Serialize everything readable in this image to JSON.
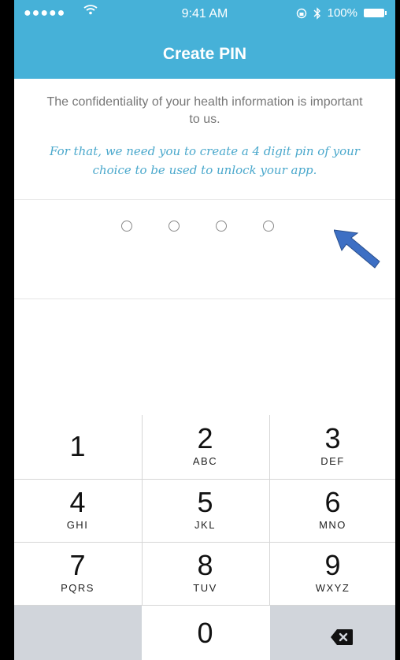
{
  "status_bar": {
    "signal": "●●●●●",
    "wifi_icon": "wifi-icon",
    "time": "9:41 AM",
    "battery_percent": "100%"
  },
  "header": {
    "title": "Create PIN"
  },
  "intro_text": "The confidentiality of your health information is important to us.",
  "instruction_text": "For that, we need you to create a 4 digit pin of your choice to be used to unlock your app.",
  "pin": {
    "length": 4,
    "entered": 0
  },
  "keypad": {
    "keys": [
      {
        "digit": "1",
        "letters": ""
      },
      {
        "digit": "2",
        "letters": "ABC"
      },
      {
        "digit": "3",
        "letters": "DEF"
      },
      {
        "digit": "4",
        "letters": "GHI"
      },
      {
        "digit": "5",
        "letters": "JKL"
      },
      {
        "digit": "6",
        "letters": "MNO"
      },
      {
        "digit": "7",
        "letters": "PQRS"
      },
      {
        "digit": "8",
        "letters": "TUV"
      },
      {
        "digit": "9",
        "letters": "WXYZ"
      },
      {
        "digit": "0",
        "letters": ""
      }
    ],
    "backspace_icon": "backspace-icon"
  },
  "colors": {
    "header": "#46b1d8",
    "instruction_text": "#4aa8cc",
    "arrow": "#3d6fc4"
  }
}
